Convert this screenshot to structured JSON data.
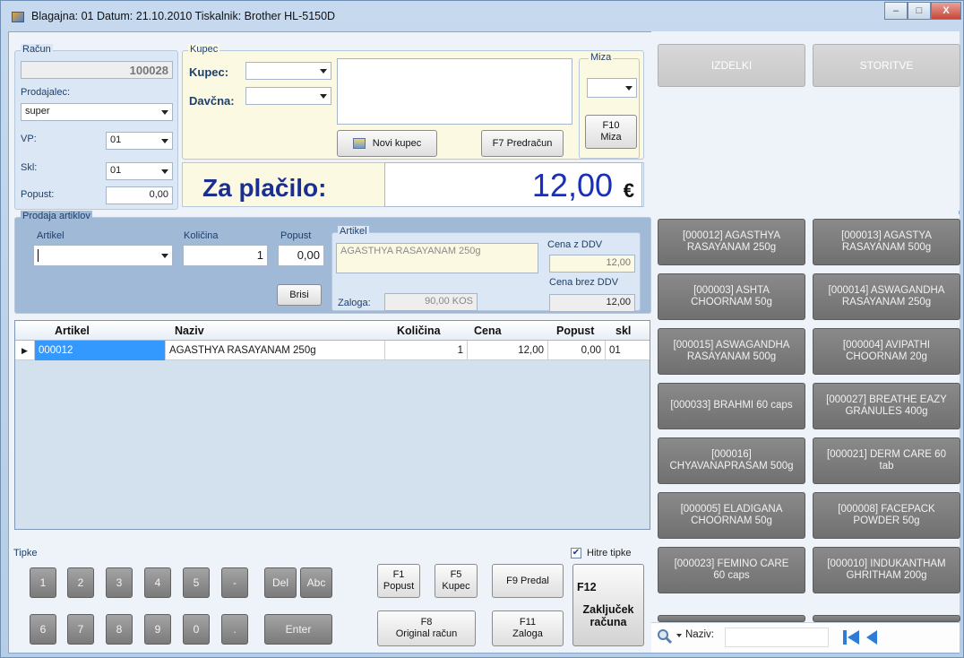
{
  "window": {
    "title": "Blagajna: 01  Datum: 21.10.2010  Tiskalnik: Brother HL-5150D",
    "min": "–",
    "max": "□",
    "close": "X"
  },
  "racun": {
    "legend": "Račun",
    "number": "100028",
    "prodajalec_label": "Prodajalec:",
    "prodajalec_value": "super",
    "vp_label": "VP:",
    "vp_value": "01",
    "skl_label": "Skl:",
    "skl_value": "01",
    "popust_label": "Popust:",
    "popust_value": "0,00"
  },
  "kupec": {
    "legend": "Kupec",
    "kupec_label": "Kupec:",
    "kupec_value": "",
    "davcna_label": "Davčna:",
    "davcna_value": "",
    "novi_kupec": "Novi kupec",
    "predracun": "F7 Predračun",
    "miza_legend": "Miza",
    "miza_value": "",
    "miza_btn_line1": "F10",
    "miza_btn_line2": "Miza"
  },
  "total": {
    "label": "Za plačilo:",
    "value": "12,00",
    "currency": "€"
  },
  "prodaja": {
    "legend": "Prodaja artiklov",
    "artikel_label": "Artikel",
    "artikel_value": "",
    "kolicina_label": "Količina",
    "kolicina_value": "1",
    "popust_label": "Popust",
    "popust_value": "0,00",
    "brisi": "Brisi",
    "artikel_box_legend": "Artikel",
    "artikel_name": "AGASTHYA RASAYANAM 250g",
    "cena_z_ddv_label": "Cena z DDV",
    "cena_z_ddv": "12,00",
    "cena_brez_ddv_label": "Cena brez DDV",
    "cena_brez_ddv": "12,00",
    "zaloga_label": "Zaloga:",
    "zaloga_value": "90,00 KOS"
  },
  "grid": {
    "columns": [
      "Artikel",
      "Naziv",
      "Količina",
      "Cena",
      "Popust",
      "skl"
    ],
    "rows": [
      {
        "artikel": "000012",
        "naziv": "AGASTHYA RASAYANAM 250g",
        "kolicina": "1",
        "cena": "12,00",
        "popust": "0,00",
        "skl": "01"
      }
    ]
  },
  "keypad": {
    "legend": "Tipke",
    "row1": [
      "1",
      "2",
      "3",
      "4",
      "5",
      "-",
      "Del",
      "Abc"
    ],
    "row2": [
      "6",
      "7",
      "8",
      "9",
      "0",
      ".",
      "Enter"
    ]
  },
  "fkeys": {
    "f1_a": "F1",
    "f1_b": "Popust",
    "f5_a": "F5",
    "f5_b": "Kupec",
    "f9": "F9  Predal",
    "f8_a": "F8",
    "f8_b": "Original račun",
    "f11_a": "F11",
    "f11_b": "Zaloga",
    "f12_a": "F12",
    "f12_b": "Zaključek",
    "f12_c": "računa",
    "hitre_tipke": "Hitre tipke"
  },
  "categories": [
    "IZDELKI",
    "STORITVE"
  ],
  "products": [
    [
      "[000012]  AGASTHYA",
      "RASAYANAM 250g"
    ],
    [
      "[000013]  AGASTYA",
      "RASAYANAM 500g"
    ],
    [
      "[000003]  ASHTA",
      "CHOORNAM 50g"
    ],
    [
      "[000014]  ASWAGANDHA",
      "RASAYANAM 250g"
    ],
    [
      "[000015]  ASWAGANDHA",
      "RASAYANAM 500g"
    ],
    [
      "[000004]  AVIPATHI",
      "CHOORNAM 20g"
    ],
    [
      "[000033]  BRAHMI  60 caps",
      ""
    ],
    [
      "[000027]  BREATHE EAZY",
      "GRANULES 400g"
    ],
    [
      "[000016]",
      "CHYAVANAPRASAM 500g"
    ],
    [
      "[000021]  DERM CARE 60",
      "tab"
    ],
    [
      "[000005]  ELADIGANA",
      "CHOORNAM 50g"
    ],
    [
      "[000008]  FACEPACK",
      "POWDER 50g"
    ],
    [
      "[000023]  FEMINO CARE",
      "60 caps"
    ],
    [
      "[000010]  INDUKANTHAM",
      "GHRITHAM 200g"
    ]
  ],
  "search": {
    "label": "Naziv:",
    "value": ""
  }
}
